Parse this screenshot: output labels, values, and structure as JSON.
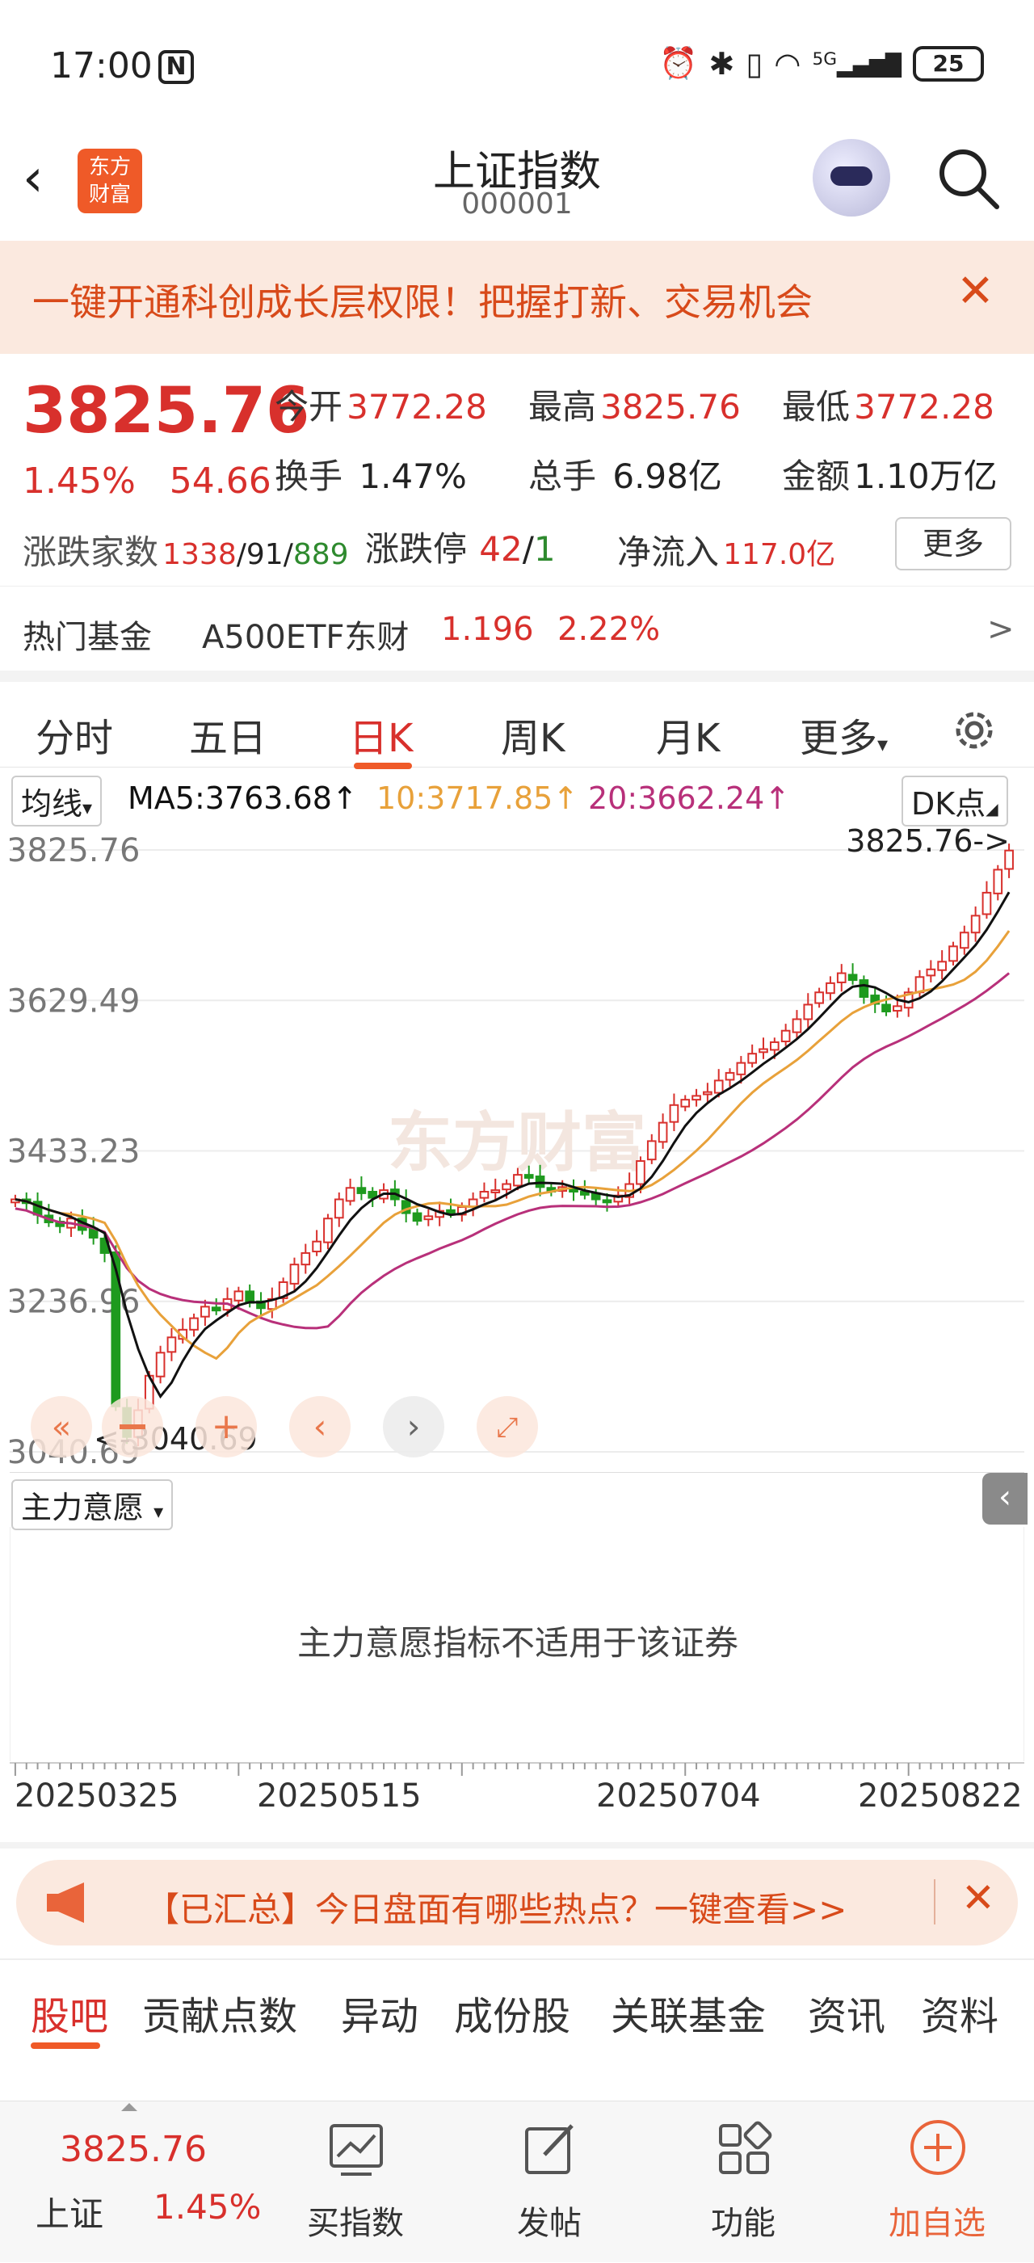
{
  "status": {
    "time": "17:00",
    "nfc": "N",
    "network": "5G",
    "battery": "25"
  },
  "header": {
    "title": "上证指数",
    "code": "000001",
    "logo_line1": "东方",
    "logo_line2": "财富"
  },
  "banner": {
    "text": "一键开通科创成长层权限！把握打新、交易机会"
  },
  "quote": {
    "price": "3825.76",
    "change_pct": "1.45%",
    "change": "54.66",
    "open_label": "今开",
    "open": "3772.28",
    "high_label": "最高",
    "high": "3825.76",
    "low_label": "最低",
    "low": "3772.28",
    "turnover_label": "换手",
    "turnover": "1.47%",
    "volume_label": "总手",
    "volume": "6.98亿",
    "amount_label": "金额",
    "amount": "1.10万亿",
    "breadth_label": "涨跌家数",
    "up_count": "1338",
    "flat_count": "91",
    "down_count": "889",
    "limit_label": "涨跌停",
    "limit_up": "42",
    "limit_down": "1",
    "inflow_label": "净流入",
    "inflow": "117.0亿",
    "more": "更多"
  },
  "fund": {
    "label": "热门基金",
    "name": "A500ETF东财",
    "price": "1.196",
    "pct": "2.22%",
    "arrow": ">"
  },
  "tabs": [
    "分时",
    "五日",
    "日K",
    "周K",
    "月K",
    "更多"
  ],
  "ma": {
    "select": "均线",
    "ma5": "MA5:3763.68↑",
    "ma10": "10:3717.85↑",
    "ma20": "20:3662.24↑",
    "dk": "DK点"
  },
  "chart_data": {
    "type": "candlestick",
    "y_labels": [
      "3825.76",
      "3629.49",
      "3433.23",
      "3236.96",
      "3040.69"
    ],
    "ylim": [
      3040.69,
      3825.76
    ],
    "max_marker": "3825.76->",
    "min_marker": "<-3040.69",
    "x_labels": [
      "20250325",
      "20250515",
      "20250704",
      "20250822"
    ],
    "watermark": "东方财富",
    "ma5_color": "#111111",
    "ma10_color": "#e8a13a",
    "ma20_color": "#b8307a",
    "up_color": "#d8302c",
    "down_color": "#1e9a1e",
    "close_series": [
      3370,
      3365,
      3350,
      3340,
      3335,
      3345,
      3330,
      3320,
      3300,
      3100,
      3060,
      3095,
      3140,
      3170,
      3190,
      3200,
      3215,
      3230,
      3225,
      3240,
      3250,
      3235,
      3228,
      3240,
      3262,
      3285,
      3300,
      3315,
      3345,
      3370,
      3385,
      3378,
      3372,
      3382,
      3370,
      3352,
      3342,
      3348,
      3355,
      3352,
      3360,
      3370,
      3380,
      3382,
      3390,
      3402,
      3398,
      3386,
      3380,
      3386,
      3380,
      3376,
      3370,
      3366,
      3375,
      3390,
      3420,
      3446,
      3470,
      3493,
      3500,
      3505,
      3510,
      3525,
      3535,
      3548,
      3560,
      3566,
      3575,
      3590,
      3605,
      3624,
      3640,
      3652,
      3665,
      3656,
      3634,
      3625,
      3615,
      3622,
      3640,
      3660,
      3670,
      3680,
      3700,
      3718,
      3740,
      3770,
      3800,
      3825
    ]
  },
  "subchart": {
    "select": "主力意愿",
    "message": "主力意愿指标不适用于该证券"
  },
  "promo": {
    "text": "【已汇总】今日盘面有哪些热点？一键查看>>"
  },
  "bar_tabs": [
    "股吧",
    "贡献点数",
    "异动",
    "成份股",
    "关联基金",
    "资讯",
    "资料"
  ],
  "bottom": {
    "price": "3825.76",
    "name": "上证",
    "pct": "1.45%",
    "buy": "买指数",
    "post": "发帖",
    "func": "功能",
    "add": "加自选"
  }
}
